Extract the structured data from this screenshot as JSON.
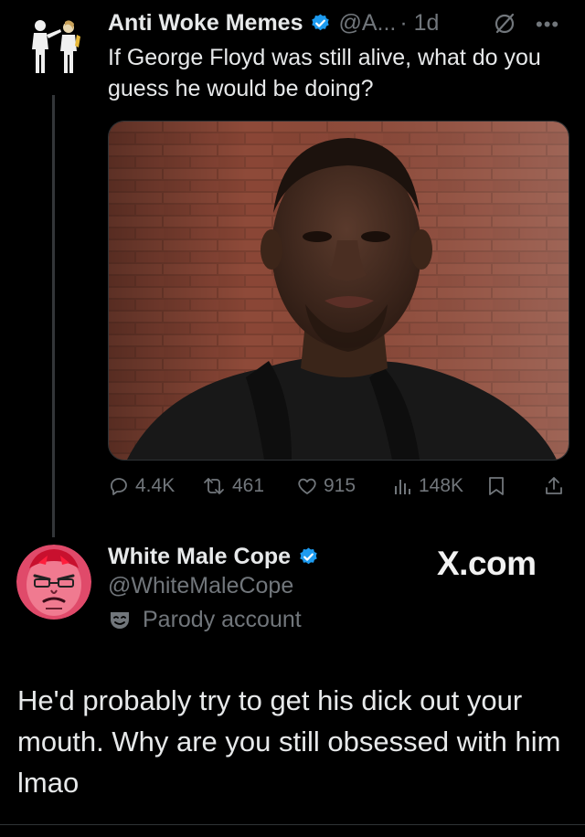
{
  "tweet1": {
    "display_name": "Anti Woke Memes",
    "handle": "@A...",
    "time": "· 1d",
    "text": "If George Floyd was still alive, what do you guess he would be doing?",
    "avatar_icon": "silhouette-figures-icon",
    "media_icon": "portrait-photo",
    "stats": {
      "replies": "4.4K",
      "reposts": "461",
      "likes": "915",
      "views": "148K"
    }
  },
  "tweet2": {
    "display_name": "White Male Cope",
    "handle": "@WhiteMaleCope",
    "label": "Parody account",
    "text": "He'd probably try to get his dick out your mouth. Why are you still obsessed with him lmao",
    "avatar_icon": "red-angry-face-avatar"
  },
  "watermark": "X.com",
  "colors": {
    "background": "#000000",
    "text": "#e7e9ea",
    "muted": "#71767b",
    "verified": "#1d9bf0",
    "divider": "#2f3336"
  }
}
